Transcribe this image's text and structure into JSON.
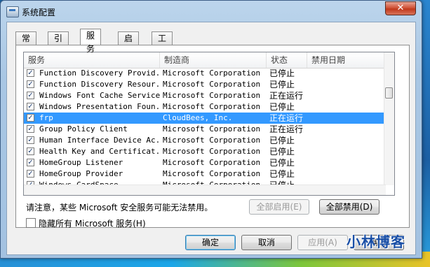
{
  "window": {
    "title": "系统配置",
    "close_glyph": "✕"
  },
  "tabs": [
    {
      "label": "常规",
      "active": false
    },
    {
      "label": "引导",
      "active": false
    },
    {
      "label": "服务",
      "active": true
    },
    {
      "label": "启动",
      "active": false
    },
    {
      "label": "工具",
      "active": false
    }
  ],
  "list": {
    "columns": [
      "服务",
      "制造商",
      "状态",
      "禁用日期"
    ],
    "rows": [
      {
        "checked": true,
        "name": "Function Discovery Provid...",
        "vendor": "Microsoft Corporation",
        "status": "已停止",
        "selected": false
      },
      {
        "checked": true,
        "name": "Function Discovery Resour...",
        "vendor": "Microsoft Corporation",
        "status": "已停止",
        "selected": false
      },
      {
        "checked": true,
        "name": "Windows Font Cache Service",
        "vendor": "Microsoft Corporation",
        "status": "正在运行",
        "selected": false
      },
      {
        "checked": true,
        "name": "Windows Presentation Foun...",
        "vendor": "Microsoft Corporation",
        "status": "已停止",
        "selected": false
      },
      {
        "checked": true,
        "name": "frp",
        "vendor": "CloudBees, Inc.",
        "status": "正在运行",
        "selected": true
      },
      {
        "checked": true,
        "name": "Group Policy Client",
        "vendor": "Microsoft Corporation",
        "status": "正在运行",
        "selected": false
      },
      {
        "checked": true,
        "name": "Human Interface Device Ac...",
        "vendor": "Microsoft Corporation",
        "status": "已停止",
        "selected": false
      },
      {
        "checked": true,
        "name": "Health Key and Certificat...",
        "vendor": "Microsoft Corporation",
        "status": "已停止",
        "selected": false
      },
      {
        "checked": true,
        "name": "HomeGroup Listener",
        "vendor": "Microsoft Corporation",
        "status": "已停止",
        "selected": false
      },
      {
        "checked": true,
        "name": "HomeGroup Provider",
        "vendor": "Microsoft Corporation",
        "status": "已停止",
        "selected": false
      },
      {
        "checked": true,
        "name": "Windows CardSpace",
        "vendor": "Microsoft Corporation",
        "status": "已停止",
        "selected": false
      }
    ]
  },
  "notice": "请注意，某些 Microsoft 安全服务可能无法禁用。",
  "buttons": {
    "enable_all": "全部启用(E)",
    "disable_all": "全部禁用(D)",
    "ok": "确定",
    "cancel": "取消",
    "apply": "应用(A)",
    "help": "帮助"
  },
  "hide_ms": {
    "label": "隐藏所有 Microsoft 服务(H)",
    "checked": false
  },
  "watermark": "小林博客"
}
